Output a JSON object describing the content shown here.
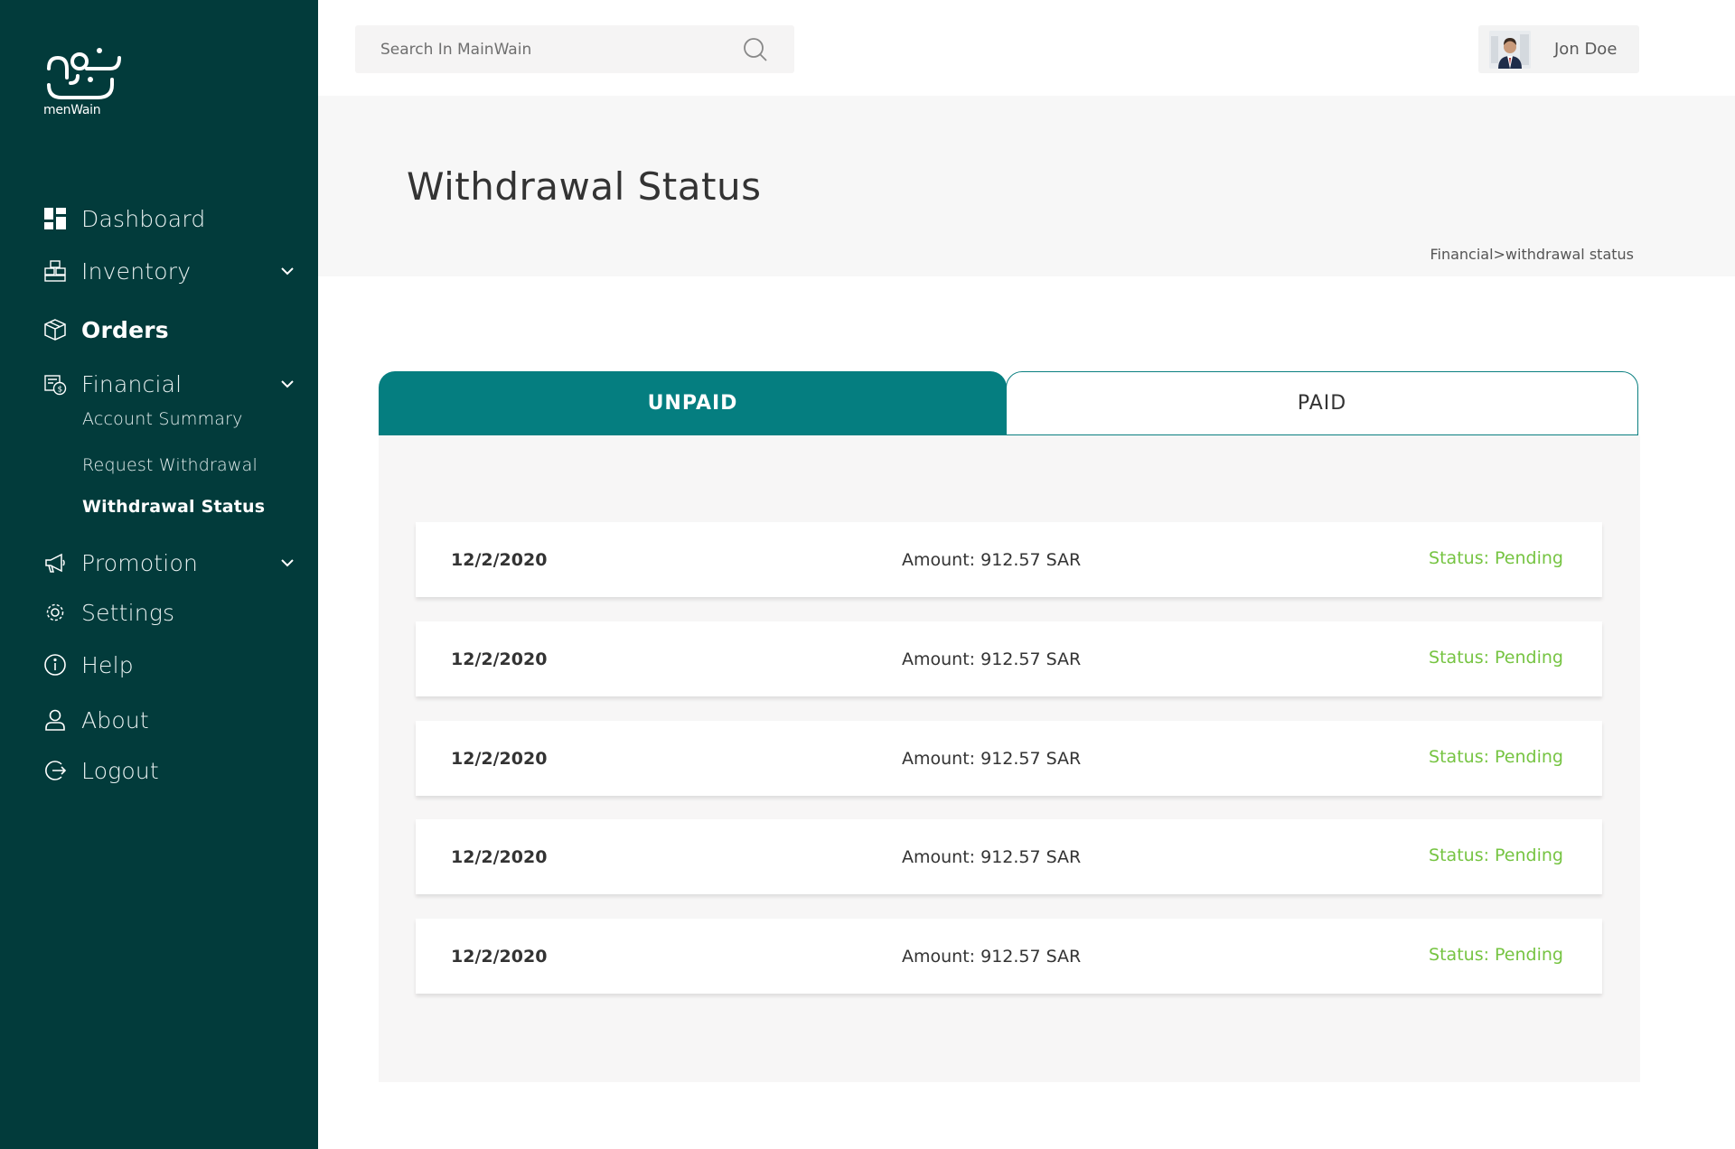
{
  "brand": {
    "logo_text": "menWain"
  },
  "search": {
    "placeholder": "Search In MainWain"
  },
  "user": {
    "name": "Jon Doe"
  },
  "sidebar": {
    "items": [
      {
        "label": "Dashboard",
        "icon": "dashboard-icon"
      },
      {
        "label": "Inventory",
        "icon": "inventory-icon"
      },
      {
        "label": "Orders",
        "icon": "orders-icon"
      },
      {
        "label": "Financial",
        "icon": "financial-icon"
      },
      {
        "label": "Promotion",
        "icon": "megaphone-icon"
      },
      {
        "label": "Settings",
        "icon": "gear-icon"
      },
      {
        "label": "Help",
        "icon": "info-icon"
      },
      {
        "label": "About",
        "icon": "user-icon"
      },
      {
        "label": "Logout",
        "icon": "logout-icon"
      }
    ],
    "financial_sub": [
      {
        "label": "Account Summary"
      },
      {
        "label": "Request Withdrawal"
      },
      {
        "label": "Withdrawal Status"
      }
    ]
  },
  "page": {
    "title": "Withdrawal Status",
    "breadcrumb": "Financial>withdrawal status"
  },
  "tabs": [
    {
      "label": "UNPAID"
    },
    {
      "label": "PAID"
    }
  ],
  "rows": [
    {
      "date": "12/2/2020",
      "amount": "Amount: 912.57 SAR",
      "status": "Status:  Pending"
    },
    {
      "date": "12/2/2020",
      "amount": "Amount: 912.57 SAR",
      "status": "Status:  Pending"
    },
    {
      "date": "12/2/2020",
      "amount": "Amount: 912.57 SAR",
      "status": "Status:  Pending"
    },
    {
      "date": "12/2/2020",
      "amount": "Amount: 912.57 SAR",
      "status": "Status:  Pending"
    },
    {
      "date": "12/2/2020",
      "amount": "Amount: 912.57 SAR",
      "status": "Status:  Pending"
    }
  ],
  "colors": {
    "sidebar_bg": "#023b3b",
    "accent": "#057e80",
    "status_pending": "#76c442",
    "panel_bg": "#f7f6f6"
  }
}
